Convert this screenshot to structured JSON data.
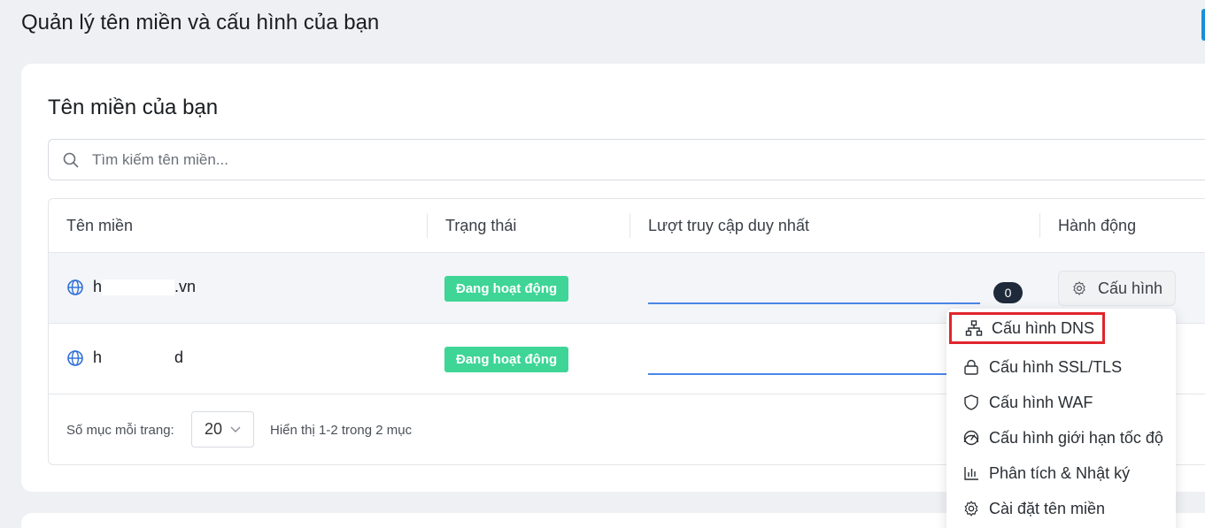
{
  "page": {
    "title": "Quản lý tên miền và cấu hình của bạn"
  },
  "card": {
    "title": "Tên miền của bạn",
    "search": {
      "placeholder": "Tìm kiếm tên miền...",
      "value": ""
    }
  },
  "table": {
    "headers": [
      "Tên miền",
      "Trạng thái",
      "Lượt truy cập duy nhất",
      "Hành động"
    ],
    "rows": [
      {
        "domain_visible": "h.vn",
        "domain_prefix": "h",
        "domain_suffix": ".vn",
        "status": "Đang hoạt động",
        "unique_visits": "0",
        "progress": 1.0,
        "action": "Cấu hình"
      },
      {
        "domain_visible": "...ed",
        "domain_prefix": "h",
        "domain_suffix": "d",
        "status": "Đang hoạt động",
        "unique_visits": "",
        "progress": 1.0,
        "action": ""
      }
    ]
  },
  "pagination": {
    "per_page_label": "Số mục mỗi trang:",
    "per_page_value": "20",
    "info": "Hiển thị 1-2 trong 2 mục"
  },
  "menu": {
    "items": [
      {
        "label": "Cấu hình DNS",
        "icon": "sitemap-icon",
        "highlighted": true
      },
      {
        "label": "Cấu hình SSL/TLS",
        "icon": "lock-icon"
      },
      {
        "label": "Cấu hình WAF",
        "icon": "shield-icon"
      },
      {
        "label": "Cấu hình giới hạn tốc độ",
        "icon": "gauge-icon"
      },
      {
        "label": "Phân tích & Nhật ký",
        "icon": "bar-chart-icon"
      },
      {
        "label": "Cài đặt tên miền",
        "icon": "gear-icon"
      }
    ]
  },
  "colors": {
    "accent": "#1a8fd8",
    "badge": "#3ed596",
    "bar": "#4a86e8",
    "highlight_box": "#e0252c"
  }
}
